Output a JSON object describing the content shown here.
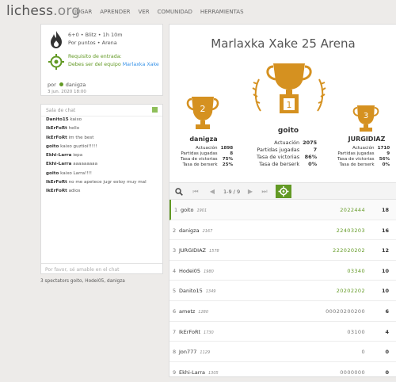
{
  "nav": {
    "logo_main": "lichess",
    "logo_tld": ".org",
    "links": [
      "JUGAR",
      "APRENDER",
      "VER",
      "COMUNIDAD",
      "HERRAMIENTAS"
    ]
  },
  "info": {
    "line1": "6+0 • Blitz • 1h 10m",
    "line2": "Por puntos • Arena",
    "req_title": "Requisito de entrada:",
    "req_text": "Debes ser del equipo ",
    "req_team": "Marlaxka Xake",
    "by_label": "por",
    "by_user": "danigza",
    "date": "3 jun. 2020 18:00"
  },
  "chat": {
    "header": "Sala de chat",
    "messages": [
      {
        "user": "Danito15",
        "text": "kaixo"
      },
      {
        "user": "IkErFoRt",
        "text": "hello"
      },
      {
        "user": "IkErFoRt",
        "text": "im the best"
      },
      {
        "user": "goito",
        "text": "kaixo guztioi!!!!!"
      },
      {
        "user": "Ekhi-Larra",
        "text": "iepa"
      },
      {
        "user": "Ekhi-Larra",
        "text": "aaaaaaaaa"
      },
      {
        "user": "goito",
        "text": "kaixo Larra!!!!"
      },
      {
        "user": "IkErFoRt",
        "text": "no me apetece jugr estoy muy mal"
      },
      {
        "user": "IkErFoRt",
        "text": "adios"
      }
    ],
    "placeholder": "Por favor, sé amable en el chat",
    "spectators": "3 spectators goito, Hodei05, danigza"
  },
  "tournament": {
    "title": "Marlaxka Xake 25 Arena",
    "podium": [
      {
        "place": "2",
        "name": "danigza",
        "stats": [
          [
            "Actuación",
            "1898"
          ],
          [
            "Partidas jugadas",
            "8"
          ],
          [
            "Tasa de victorias",
            "75%"
          ],
          [
            "Tasa de berserk",
            "25%"
          ]
        ]
      },
      {
        "place": "1",
        "name": "goito",
        "stats": [
          [
            "Actuación",
            "2075"
          ],
          [
            "Partidas jugadas",
            "7"
          ],
          [
            "Tasa de victorias",
            "86%"
          ],
          [
            "Tasa de berserk",
            "0%"
          ]
        ]
      },
      {
        "place": "3",
        "name": "JURGIDIAZ",
        "stats": [
          [
            "Actuación",
            "1710"
          ],
          [
            "Partidas jugadas",
            "9"
          ],
          [
            "Tasa de victorias",
            "56%"
          ],
          [
            "Tasa de berserk",
            "0%"
          ]
        ]
      }
    ]
  },
  "pager": {
    "range": "1-9 / 9"
  },
  "standings": [
    {
      "rank": "1",
      "name": "goito",
      "rating": "1901",
      "sheet": "2022444",
      "score": "18",
      "green": true
    },
    {
      "rank": "2",
      "name": "danigza",
      "rating": "2167",
      "sheet": "22403203",
      "score": "16",
      "green": true
    },
    {
      "rank": "3",
      "name": "JURGIDIAZ",
      "rating": "1578",
      "sheet": "222020202",
      "score": "12",
      "green": true
    },
    {
      "rank": "4",
      "name": "Hodei05",
      "rating": "1980",
      "sheet": "03340",
      "score": "10",
      "green": true
    },
    {
      "rank": "5",
      "name": "Danito15",
      "rating": "1349",
      "sheet": "20202202",
      "score": "10",
      "green": true
    },
    {
      "rank": "6",
      "name": "ametz",
      "rating": "1280",
      "sheet": "00020200200",
      "score": "6",
      "green": false
    },
    {
      "rank": "7",
      "name": "IkErFoRt",
      "rating": "1730",
      "sheet": "03100",
      "score": "4",
      "green": false
    },
    {
      "rank": "8",
      "name": "Jon777",
      "rating": "1129",
      "sheet": "0",
      "score": "0",
      "green": false
    },
    {
      "rank": "9",
      "name": "Ekhi-Larra",
      "rating": "1305",
      "sheet": "0000000",
      "score": "0",
      "green": false
    }
  ],
  "colors": {
    "accent": "#629924",
    "gold": "#d59120",
    "link": "#3893e8"
  }
}
